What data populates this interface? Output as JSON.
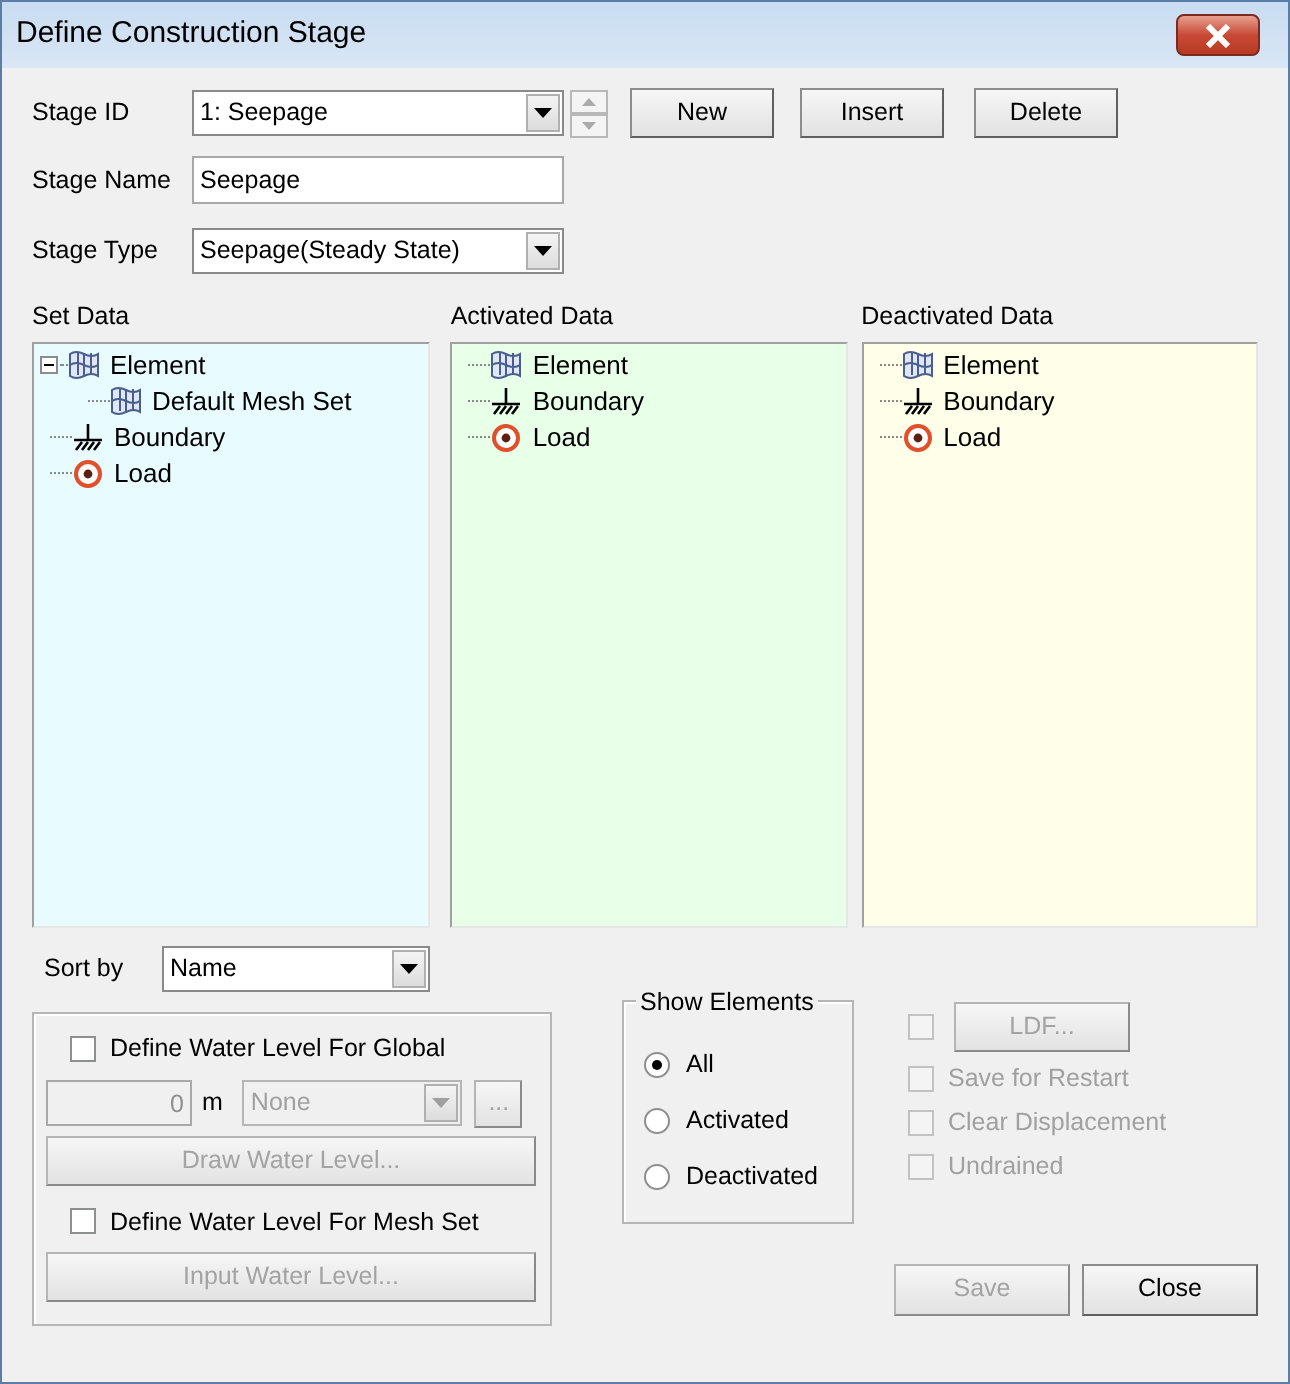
{
  "window": {
    "title": "Define Construction Stage"
  },
  "stage_id": {
    "label": "Stage ID",
    "value": "1: Seepage"
  },
  "top_buttons": [
    "New",
    "Insert",
    "Delete"
  ],
  "stage_name": {
    "label": "Stage Name",
    "value": "Seepage"
  },
  "stage_type": {
    "label": "Stage Type",
    "value": "Seepage(Steady State)"
  },
  "panels": [
    {
      "title": "Set Data",
      "color": "#e8fbff",
      "items": [
        {
          "kind": "element",
          "label": "Element",
          "expanded": true,
          "children": [
            {
              "kind": "element",
              "label": "Default Mesh Set"
            }
          ]
        },
        {
          "kind": "boundary",
          "label": "Boundary"
        },
        {
          "kind": "load",
          "label": "Load"
        }
      ]
    },
    {
      "title": "Activated Data",
      "color": "#e8ffe8",
      "items": [
        {
          "kind": "element",
          "label": "Element"
        },
        {
          "kind": "boundary",
          "label": "Boundary"
        },
        {
          "kind": "load",
          "label": "Load"
        }
      ]
    },
    {
      "title": "Deactivated Data",
      "color": "#fffee8",
      "items": [
        {
          "kind": "element",
          "label": "Element"
        },
        {
          "kind": "boundary",
          "label": "Boundary"
        },
        {
          "kind": "load",
          "label": "Load"
        }
      ]
    }
  ],
  "sort_by": {
    "label": "Sort by",
    "value": "Name"
  },
  "water": {
    "global": {
      "label": "Define Water Level For Global",
      "checked": false
    },
    "level_value": "0",
    "unit": "m",
    "level_select": "None",
    "browse": "...",
    "disabled": true,
    "draw_button": "Draw Water Level...",
    "mesh_set": {
      "label": "Define Water Level For Mesh Set",
      "checked": false
    },
    "input_button": "Input Water Level..."
  },
  "show_elements": {
    "title": "Show Elements",
    "options": [
      {
        "label": "All",
        "selected": true
      },
      {
        "label": "Activated",
        "selected": false
      },
      {
        "label": "Deactivated",
        "selected": false
      }
    ]
  },
  "options": [
    {
      "kind": "button",
      "label": "LDF...",
      "checked": false,
      "disabled": true
    },
    {
      "kind": "check",
      "label": "Save for Restart",
      "checked": false,
      "disabled": true
    },
    {
      "kind": "check",
      "label": "Clear Displacement",
      "checked": false,
      "disabled": true
    },
    {
      "kind": "check",
      "label": "Undrained",
      "checked": false,
      "disabled": true
    }
  ],
  "footer_buttons": [
    {
      "label": "Save",
      "disabled": true
    },
    {
      "label": "Close",
      "disabled": false
    }
  ]
}
